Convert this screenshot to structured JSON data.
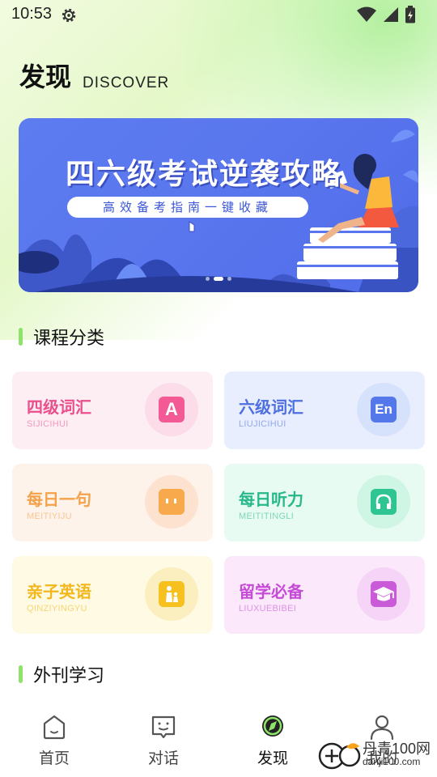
{
  "status": {
    "time": "10:53"
  },
  "header": {
    "title": "发现",
    "subtitle": "DISCOVER"
  },
  "banner": {
    "title": "四六级考试逆袭攻略",
    "subtitle": "高效备考指南一键收藏"
  },
  "sections": {
    "courses": "课程分类",
    "journals": "外刊学习"
  },
  "cards": [
    {
      "title": "四级词汇",
      "sub": "SIJICIHUI",
      "icon": "letter-a-icon",
      "glyph": "A",
      "title_color": "#e9508c",
      "bg": "#fdeef4",
      "circle": "#fbdce8",
      "icon_bg": "#f35a95"
    },
    {
      "title": "六级词汇",
      "sub": "LIUJICIHUI",
      "icon": "en-icon",
      "glyph": "En",
      "title_color": "#4d6fe0",
      "bg": "#e8eefd",
      "circle": "#d6e1fb",
      "icon_bg": "#5478ea"
    },
    {
      "title": "每日一句",
      "sub": "MEITIYIJU",
      "icon": "quote-icon",
      "glyph": "' '",
      "title_color": "#f3a24a",
      "bg": "#fef3ea",
      "circle": "#fde3cf",
      "icon_bg": "#f7a94c"
    },
    {
      "title": "每日听力",
      "sub": "MEITITINGLI",
      "icon": "headphones-icon",
      "glyph": "",
      "title_color": "#28b88a",
      "bg": "#e7fbf2",
      "circle": "#cff5e4",
      "icon_bg": "#2fc593"
    },
    {
      "title": "亲子英语",
      "sub": "QINZIYINGYU",
      "icon": "parent-child-icon",
      "glyph": "",
      "title_color": "#f3b71c",
      "bg": "#fefae4",
      "circle": "#fbefbf",
      "icon_bg": "#f6c11f"
    },
    {
      "title": "留学必备",
      "sub": "LIUXUEBIBEI",
      "icon": "graduation-cap-icon",
      "glyph": "",
      "title_color": "#c54bd6",
      "bg": "#fbe8fb",
      "circle": "#f5d4f7",
      "icon_bg": "#c95ad8"
    }
  ],
  "tabs": [
    {
      "label": "首页",
      "icon": "home-icon"
    },
    {
      "label": "对话",
      "icon": "chat-icon"
    },
    {
      "label": "发现",
      "icon": "compass-icon"
    },
    {
      "label": "我的",
      "icon": "user-icon"
    }
  ],
  "watermark": {
    "text1": "丹青100网",
    "text2": "danji100.com"
  }
}
